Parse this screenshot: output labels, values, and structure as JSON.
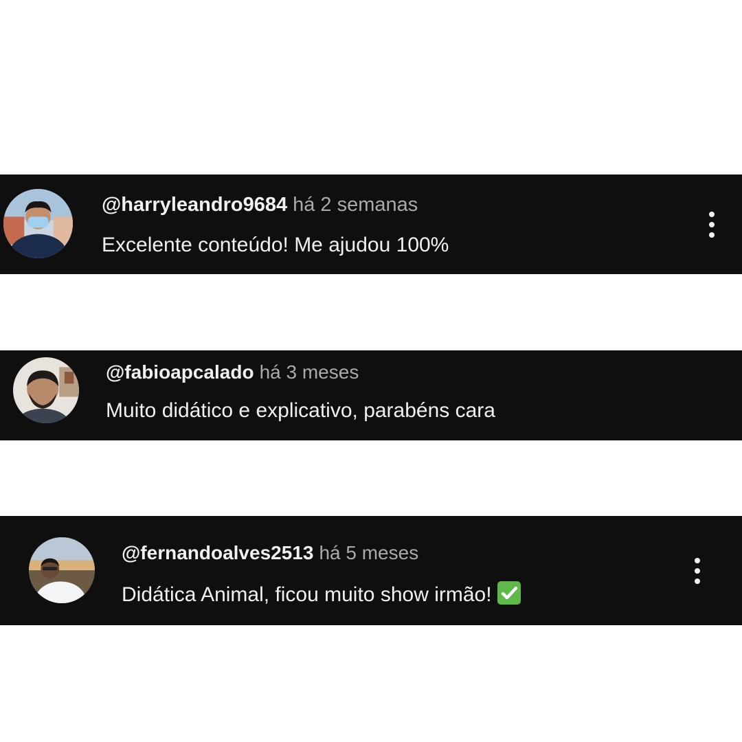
{
  "comments": [
    {
      "handle": "@harryleandro9684",
      "time": "há 2 semanas",
      "text": "Excelente conteúdo! Me ajudou 100%",
      "avatar_icon": "avatar-photo",
      "menu_icon": "more-vertical-icon"
    },
    {
      "handle": "@fabioapcalado",
      "time": "há 3 meses",
      "text": "Muito didático e explicativo, parabéns cara",
      "avatar_icon": "avatar-photo"
    },
    {
      "handle": "@fernandoalves2513",
      "time": "há 5 meses",
      "text": "Didática Animal, ficou muito show irmão!",
      "emoji": "check-mark-button-emoji",
      "avatar_icon": "avatar-photo",
      "menu_icon": "more-vertical-icon"
    }
  ],
  "colors": {
    "background": "#ffffff",
    "comment_bg": "#0f0f0f",
    "primary_text": "#f1f1f1",
    "secondary_text": "#aaaaaa",
    "check_green": "#5fb84a"
  }
}
